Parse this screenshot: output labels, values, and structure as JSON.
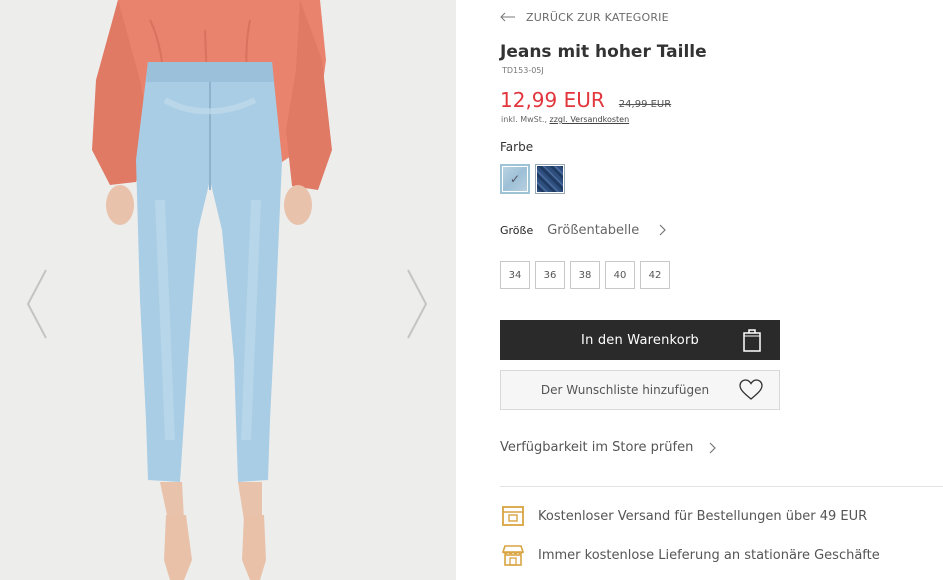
{
  "gallery": {
    "prev_icon": "chevron-left-icon",
    "next_icon": "chevron-right-icon"
  },
  "navigation": {
    "back_label": "ZURÜCK ZUR KATEGORIE",
    "back_icon": "arrow-left-icon"
  },
  "product": {
    "title": "Jeans mit hoher Taille",
    "sku": "TD153-05J",
    "price": "12,99 EUR",
    "old_price": "24,99 EUR",
    "vat_prefix": "inkl. MwSt.,",
    "shipping_link": "zzgl. Versandkosten",
    "price_color": "#e2363d"
  },
  "color": {
    "label": "Farbe",
    "swatches": [
      {
        "name": "hellblau",
        "selected": true
      },
      {
        "name": "dunkelblau",
        "selected": false
      }
    ]
  },
  "size": {
    "label": "Größe",
    "table_link": "Größentabelle",
    "options": [
      "34",
      "36",
      "38",
      "40",
      "42"
    ]
  },
  "actions": {
    "add_to_cart": "In den Warenkorb",
    "cart_icon": "shopping-bag-icon",
    "wishlist": "Der Wunschliste hinzufügen",
    "wishlist_icon": "heart-icon",
    "store_availability": "Verfügbarkeit im Store prüfen"
  },
  "benefits": [
    {
      "icon": "delivery-box-icon",
      "text": "Kostenloser Versand für Bestellungen über 49 EUR"
    },
    {
      "icon": "store-icon",
      "text": "Immer kostenlose Lieferung an stationäre Geschäfte"
    }
  ],
  "colors": {
    "accent_gold": "#d9a441",
    "button_dark": "#2a2a2a"
  }
}
